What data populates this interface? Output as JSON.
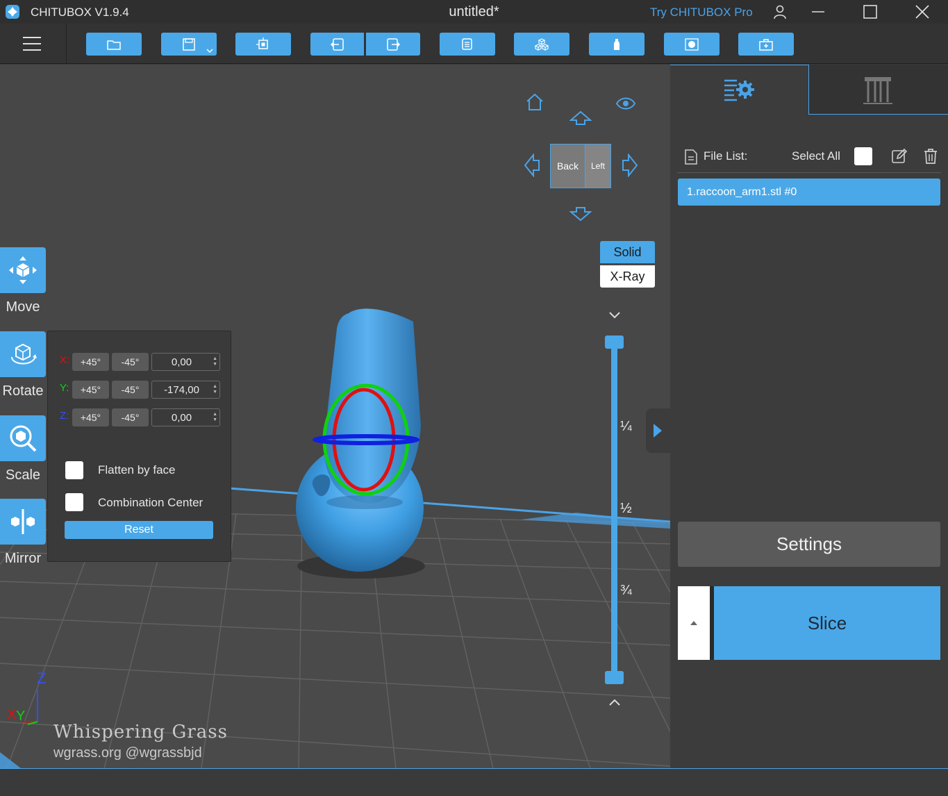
{
  "window": {
    "app_title": "CHITUBOX V1.9.4",
    "doc_title": "untitled*",
    "pro_link": "Try CHITUBOX Pro"
  },
  "toolbar": {
    "buttons": [
      "open-file",
      "save",
      "auto-layout",
      "undo",
      "redo",
      "duplicate",
      "arrange",
      "hollow",
      "dig-hole",
      "add-support"
    ]
  },
  "tools": {
    "move": "Move",
    "rotate": "Rotate",
    "scale": "Scale",
    "mirror": "Mirror"
  },
  "rotate_panel": {
    "x": {
      "label": "X:",
      "plus": "+45°",
      "minus": "-45°",
      "value": "0,00"
    },
    "y": {
      "label": "Y:",
      "plus": "+45°",
      "minus": "-45°",
      "value": "-174,00"
    },
    "z": {
      "label": "Z:",
      "plus": "+45°",
      "minus": "-45°",
      "value": "0,00"
    },
    "flatten_label": "Flatten by face",
    "combination_label": "Combination Center",
    "reset_label": "Reset"
  },
  "view_cube": {
    "back": "Back",
    "left": "Left"
  },
  "render_mode": {
    "solid": "Solid",
    "xray": "X-Ray"
  },
  "layer_slider": {
    "quarter": "¼",
    "half": "½",
    "three_quarter": "¾"
  },
  "axes": {
    "z": "Z",
    "x": "X",
    "y": "Y"
  },
  "watermark": {
    "line1": "Whispering Grass",
    "line2": "wgrass.org @wgrassbjd"
  },
  "right_panel": {
    "file_list_label": "File List:",
    "select_all_label": "Select All",
    "files": [
      "1.raccoon_arm1.stl #0"
    ],
    "settings_label": "Settings",
    "slice_label": "Slice"
  },
  "colors": {
    "accent": "#4aa8e8",
    "model": "#3f9fe3",
    "gizmo_x": "#e01010",
    "gizmo_y": "#10d010",
    "gizmo_z": "#1020e0"
  }
}
